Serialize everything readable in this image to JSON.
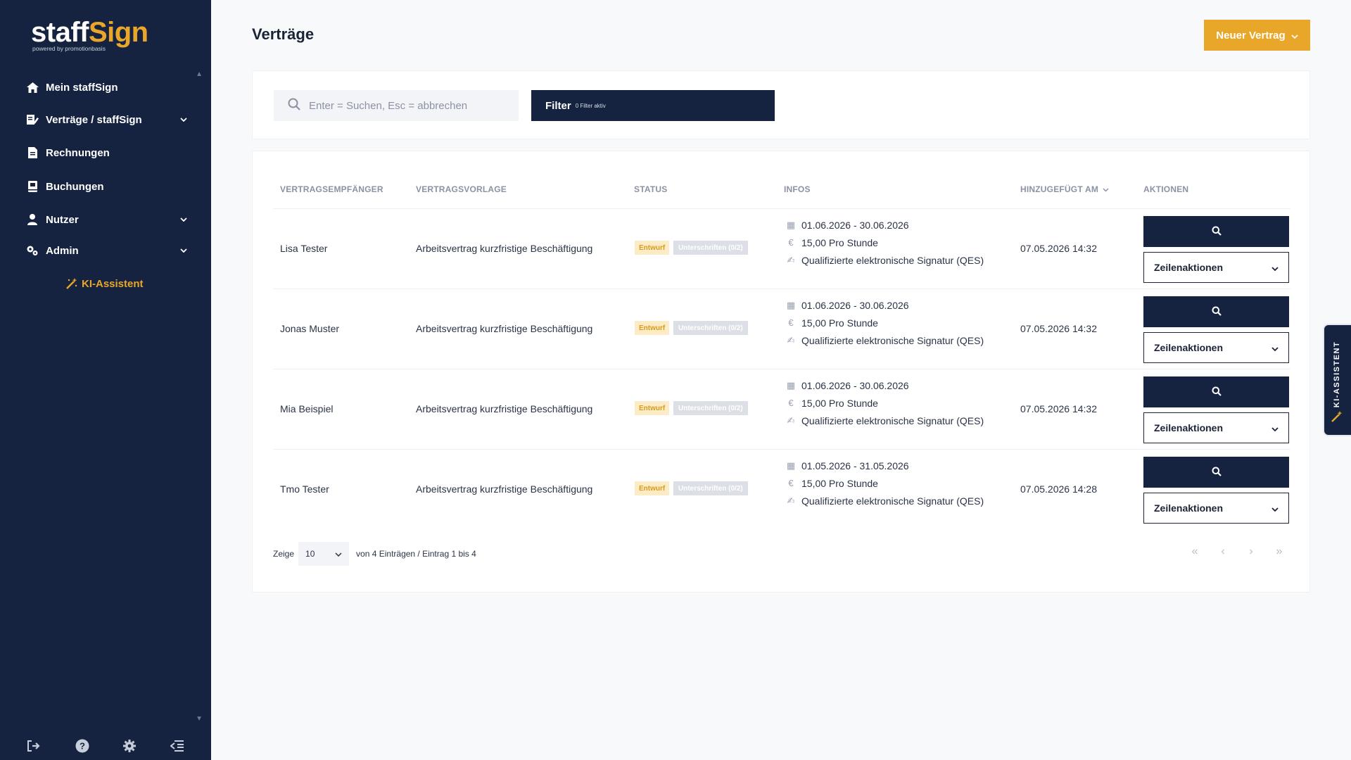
{
  "app": {
    "logo_part1": "staff",
    "logo_part2": "Sign",
    "logo_sub": "powered by promotionbasis"
  },
  "colors": {
    "sidebar": "#162340",
    "accent": "#e9a72a",
    "page_bg": "#f8f9fb"
  },
  "sidebar": {
    "items": [
      {
        "label": "Mein staffSign",
        "icon": "home-icon"
      },
      {
        "label": "Verträge / staffSign",
        "icon": "contract-edit-icon"
      },
      {
        "label": "Rechnungen",
        "icon": "invoice-icon"
      },
      {
        "label": "Buchungen",
        "icon": "booking-icon"
      },
      {
        "label": "Nutzer",
        "icon": "user-icon"
      },
      {
        "label": "Admin",
        "icon": "gears-icon"
      }
    ],
    "ki_assistant": "KI-Assistent",
    "bottom_icons": [
      "logout-icon",
      "help-icon",
      "settings-icon",
      "collapse-menu-icon"
    ]
  },
  "header": {
    "title": "Verträge",
    "new_button": "Neuer Vertrag"
  },
  "search": {
    "placeholder": "Enter = Suchen, Esc = abbrechen",
    "filter_label": "Filter",
    "filter_sub": "0 Filter aktiv"
  },
  "table": {
    "columns": {
      "recipient": "VERTRAGSEMPFÄNGER",
      "template": "VERTRAGSVORLAGE",
      "status": "STATUS",
      "infos": "INFOS",
      "added": "HINZUGEFÜGT AM",
      "actions": "AKTIONEN"
    },
    "rows": [
      {
        "recipient": "Lisa Tester",
        "template": "Arbeitsvertrag kurzfristige Beschäftigung",
        "status_draft": "Entwurf",
        "status_sign": "Unterschriften (0/2)",
        "period": "01.06.2026 - 30.06.2026",
        "rate": "15,00 Pro Stunde",
        "signature": "Qualifizierte elektronische Signatur (QES)",
        "added": "07.05.2026 14:32",
        "row_action": "Zeilenaktionen"
      },
      {
        "recipient": "Jonas Muster",
        "template": "Arbeitsvertrag kurzfristige Beschäftigung",
        "status_draft": "Entwurf",
        "status_sign": "Unterschriften (0/2)",
        "period": "01.06.2026 - 30.06.2026",
        "rate": "15,00 Pro Stunde",
        "signature": "Qualifizierte elektronische Signatur (QES)",
        "added": "07.05.2026 14:32",
        "row_action": "Zeilenaktionen"
      },
      {
        "recipient": "Mia Beispiel",
        "template": "Arbeitsvertrag kurzfristige Beschäftigung",
        "status_draft": "Entwurf",
        "status_sign": "Unterschriften (0/2)",
        "period": "01.06.2026 - 30.06.2026",
        "rate": "15,00 Pro Stunde",
        "signature": "Qualifizierte elektronische Signatur (QES)",
        "added": "07.05.2026 14:32",
        "row_action": "Zeilenaktionen"
      },
      {
        "recipient": "Tmo Tester",
        "template": "Arbeitsvertrag kurzfristige Beschäftigung",
        "status_draft": "Entwurf",
        "status_sign": "Unterschriften (0/2)",
        "period": "01.05.2026 - 31.05.2026",
        "rate": "15,00 Pro Stunde",
        "signature": "Qualifizierte elektronische Signatur (QES)",
        "added": "07.05.2026 14:28",
        "row_action": "Zeilenaktionen"
      }
    ]
  },
  "pagination": {
    "show_label": "Zeige",
    "page_size": "10",
    "summary": "von 4 Einträgen / Eintrag 1 bis 4",
    "first": "«",
    "prev": "‹",
    "next": "›",
    "last": "»"
  },
  "ki_tab": {
    "label": "KI-ASSISTENT"
  }
}
